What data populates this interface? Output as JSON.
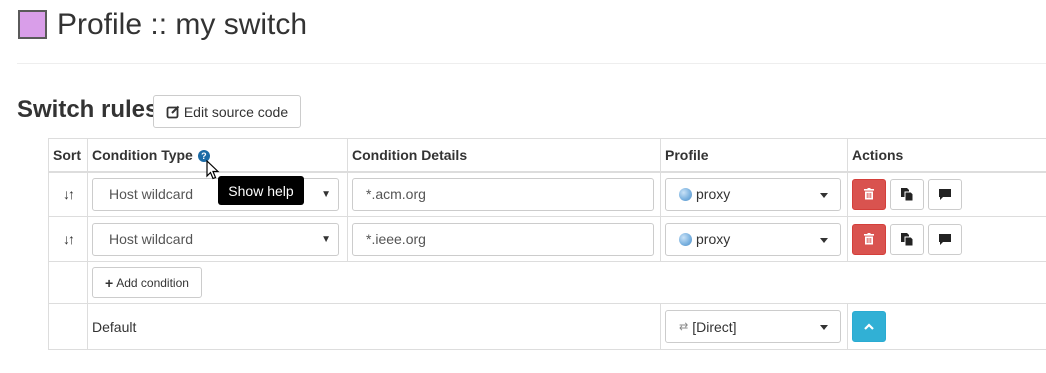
{
  "header": {
    "title": "Profile :: my switch",
    "profile_color": "#d99ee9"
  },
  "switch_rules": {
    "title": "Switch rules",
    "edit_source_label": "Edit source code",
    "columns": {
      "sort": "Sort",
      "condition_type": "Condition Type",
      "condition_details": "Condition Details",
      "profile": "Profile",
      "actions": "Actions"
    },
    "rules": [
      {
        "condition_type": "Host wildcard",
        "condition_details": "*.acm.org",
        "profile": "proxy"
      },
      {
        "condition_type": "Host wildcard",
        "condition_details": "*.ieee.org",
        "profile": "proxy"
      }
    ],
    "add_condition_label": "Add condition",
    "default_label": "Default",
    "default_profile": "[Direct]"
  },
  "tooltip": {
    "text": "Show help"
  },
  "colors": {
    "danger": "#d9534f",
    "info": "#31b0d5",
    "help_icon": "#1b6aa5"
  }
}
